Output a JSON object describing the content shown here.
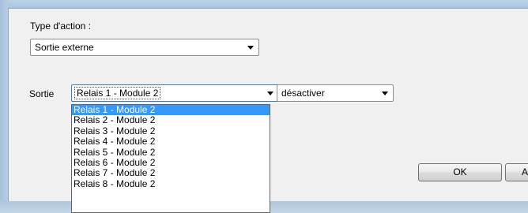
{
  "form": {
    "action_type_label": "Type d'action :",
    "action_type_value": "Sortie externe",
    "sortie_label": "Sortie",
    "sortie_value": "Relais 1 - Module 2",
    "state_value": "désactiver"
  },
  "dropdown": {
    "options": [
      "Relais 1 - Module 2",
      "Relais 2 - Module 2",
      "Relais 3 - Module 2",
      "Relais 4 - Module 2",
      "Relais 5 - Module 2",
      "Relais 6 - Module 2",
      "Relais 7 - Module 2",
      "Relais 8 - Module 2"
    ],
    "selected_index": 0
  },
  "buttons": {
    "ok_label": "OK",
    "partial_label": "A"
  }
}
